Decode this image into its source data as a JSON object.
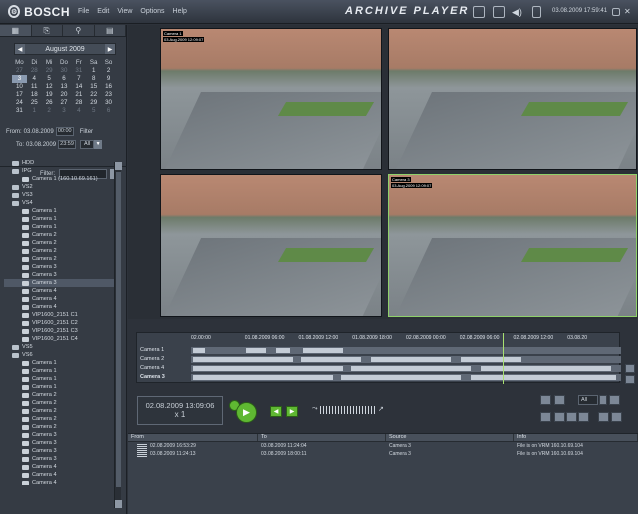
{
  "titlebar": {
    "brand": "BOSCH",
    "menu": [
      "File",
      "Edit",
      "View",
      "Options",
      "Help"
    ],
    "app_title": "ARCHIVE PLAYER",
    "clock": "03.08.2009 17:59:41"
  },
  "calendar": {
    "month_label": "August 2009",
    "day_headers": [
      "Mo",
      "Di",
      "Mi",
      "Do",
      "Fr",
      "Sa",
      "So"
    ],
    "weeks": [
      [
        "27",
        "28",
        "29",
        "30",
        "31",
        "1",
        "2"
      ],
      [
        "3",
        "4",
        "5",
        "6",
        "7",
        "8",
        "9"
      ],
      [
        "10",
        "11",
        "12",
        "13",
        "14",
        "15",
        "16"
      ],
      [
        "17",
        "18",
        "19",
        "20",
        "21",
        "22",
        "23"
      ],
      [
        "24",
        "25",
        "26",
        "27",
        "28",
        "29",
        "30"
      ],
      [
        "31",
        "1",
        "2",
        "3",
        "4",
        "5",
        "6"
      ]
    ],
    "from_label": "From:",
    "from_date": "03.08.2009",
    "from_time": "00:00",
    "filter_label": "Filter",
    "to_label": "To:",
    "to_date": "03.08.2009",
    "to_time": "23:59",
    "filter_value": "All"
  },
  "tree": {
    "filter_label": "Filter:",
    "items": [
      "HDD",
      "IPG",
      "Camera 1 (160.10.69.161)",
      "VS2",
      "VS3",
      "VS4",
      "Camera 1",
      "Camera 1",
      "Camera 1",
      "Camera 2",
      "Camera 2",
      "Camera 2",
      "Camera 2",
      "Camera 3",
      "Camera 3",
      "Camera 3",
      "Camera 4",
      "Camera 4",
      "Camera 4",
      "VIP1600_2151 C1",
      "VIP1600_2151 C2",
      "VIP1600_2151 C3",
      "VIP1600_2151 C4",
      "VS5",
      "VS6",
      "Camera 1",
      "Camera 1",
      "Camera 1",
      "Camera 1",
      "Camera 2",
      "Camera 2",
      "Camera 2",
      "Camera 2",
      "Camera 2",
      "Camera 3",
      "Camera 3",
      "Camera 3",
      "Camera 3",
      "Camera 4",
      "Camera 4",
      "Camera 4",
      "Camera 4",
      "Camera 4"
    ],
    "selected_index": 15
  },
  "video": {
    "tiles": [
      {
        "label": "Camera 1",
        "time": "03.Aug.2009 12:09:07"
      },
      {
        "label": "",
        "time": ""
      },
      {
        "label": "",
        "time": ""
      },
      {
        "label": "Camera 3",
        "time": "03.Aug.2009 12:09:07"
      }
    ]
  },
  "timeline": {
    "ticks": [
      "02.00:00",
      "01.08.2009 06:00",
      "01.08.2009 12:00",
      "01.08.2009 18:00",
      "02.08.2009 00:00",
      "02.08.2009 06:00",
      "02.08.2009 12:00",
      "03.08.20"
    ],
    "tracks": [
      "Camera 1",
      "Camera 2",
      "Camera 4",
      "Camera 3"
    ]
  },
  "playback": {
    "current_time": "02.08.2009 13:09:06",
    "speed": "x 1",
    "filter_select": "All"
  },
  "results": {
    "headers": [
      "From",
      "To",
      "Source",
      "Info"
    ],
    "rows": [
      [
        "02.08.2009 16:53:29",
        "03.08.2009 11:24:04",
        "Camera 3",
        "File is on VRM 160.10.69.104"
      ],
      [
        "03.08.2009 11:24:13",
        "03.08.2009 18:00:11",
        "Camera 3",
        "File is on VRM 160.10.69.104"
      ]
    ]
  }
}
